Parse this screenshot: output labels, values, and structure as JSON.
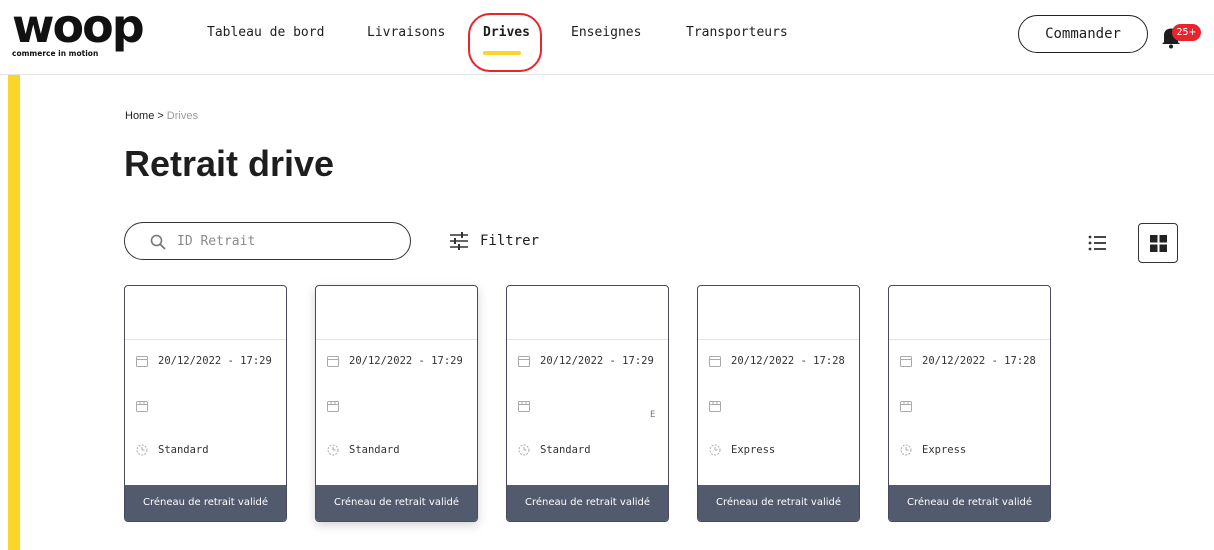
{
  "brand": {
    "logo_text": "woop",
    "tagline": "commerce in motion"
  },
  "nav": {
    "items": [
      {
        "label": "Tableau de bord"
      },
      {
        "label": "Livraisons"
      },
      {
        "label": "Drives",
        "active": true
      },
      {
        "label": "Enseignes"
      },
      {
        "label": "Transporteurs"
      }
    ],
    "highlight_color": "#e8242c"
  },
  "header": {
    "order_button": "Commander",
    "notification_badge": "25+"
  },
  "colors": {
    "accent_yellow": "#fbd52a",
    "card_footer": "#525a6e",
    "badge_red": "#e8242c"
  },
  "breadcrumb": {
    "home": "Home",
    "separator": ">",
    "current": "Drives"
  },
  "page": {
    "title": "Retrait drive"
  },
  "search": {
    "placeholder": "ID Retrait",
    "value": ""
  },
  "filter": {
    "label": "Filtrer"
  },
  "view_modes": {
    "list_icon": "list-icon",
    "grid_icon": "grid-icon",
    "active": "grid"
  },
  "cards": [
    {
      "datetime": "20/12/2022 - 17:29",
      "store": "",
      "type": "Standard",
      "status": "Créneau de retrait validé"
    },
    {
      "datetime": "20/12/2022 - 17:29",
      "store": "",
      "type": "Standard",
      "status": "Créneau de retrait validé"
    },
    {
      "datetime": "20/12/2022 - 17:29",
      "store": "",
      "type": "Standard",
      "status": "Créneau de retrait validé",
      "mark": "E"
    },
    {
      "datetime": "20/12/2022 - 17:28",
      "store": "",
      "type": "Express",
      "status": "Créneau de retrait validé"
    },
    {
      "datetime": "20/12/2022 - 17:28",
      "store": "",
      "type": "Express",
      "status": "Créneau de retrait validé"
    }
  ]
}
